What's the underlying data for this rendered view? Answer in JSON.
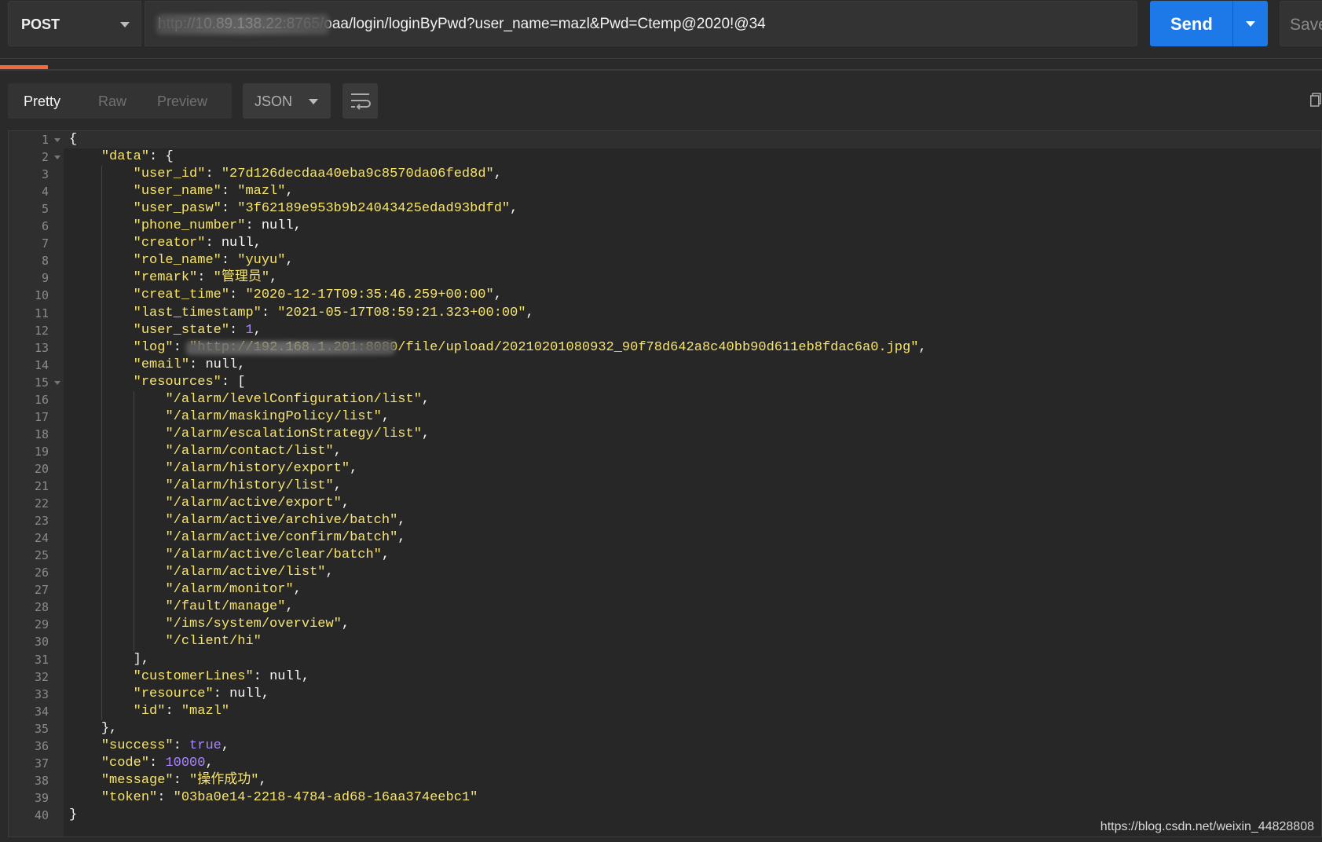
{
  "request": {
    "method": "POST",
    "url": "http://10.89.138.22:8765/oaa/login/loginByPwd?user_name=mazl&Pwd=Ctemp@2020!@34",
    "send_label": "Send",
    "save_label": "Save"
  },
  "response_view": {
    "tabs": [
      "Pretty",
      "Raw",
      "Preview"
    ],
    "active_tab": "Pretty",
    "format": "JSON"
  },
  "code_lines": [
    "{",
    "    \"data\": {",
    "        \"user_id\": \"27d126decdaa40eba9c8570da06fed8d\",",
    "        \"user_name\": \"mazl\",",
    "        \"user_pasw\": \"3f62189e953b9b24043425edad93bdfd\",",
    "        \"phone_number\": null,",
    "        \"creator\": null,",
    "        \"role_name\": \"yuyu\",",
    "        \"remark\": \"管理员\",",
    "        \"creat_time\": \"2020-12-17T09:35:46.259+00:00\",",
    "        \"last_timestamp\": \"2021-05-17T08:59:21.323+00:00\",",
    "        \"user_state\": 1,",
    "        \"log\": \"http://192.168.1.201:8080/file/upload/20210201080932_90f78d642a8c40bb90d611eb8fdac6a0.jpg\",",
    "        \"email\": null,",
    "        \"resources\": [",
    "            \"/alarm/levelConfiguration/list\",",
    "            \"/alarm/maskingPolicy/list\",",
    "            \"/alarm/escalationStrategy/list\",",
    "            \"/alarm/contact/list\",",
    "            \"/alarm/history/export\",",
    "            \"/alarm/history/list\",",
    "            \"/alarm/active/export\",",
    "            \"/alarm/active/archive/batch\",",
    "            \"/alarm/active/confirm/batch\",",
    "            \"/alarm/active/clear/batch\",",
    "            \"/alarm/active/list\",",
    "            \"/alarm/monitor\",",
    "            \"/fault/manage\",",
    "            \"/ims/system/overview\",",
    "            \"/client/hi\"",
    "        ],",
    "        \"customerLines\": null,",
    "        \"resource\": null,",
    "        \"id\": \"mazl\"",
    "    },",
    "    \"success\": true,",
    "    \"code\": 10000,",
    "    \"message\": \"操作成功\",",
    "    \"token\": \"03ba0e14-2218-4784-ad68-16aa374eebc1\"",
    "}"
  ],
  "fold_lines": [
    1,
    2,
    15
  ],
  "watermark": "https://blog.csdn.net/weixin_44828808"
}
